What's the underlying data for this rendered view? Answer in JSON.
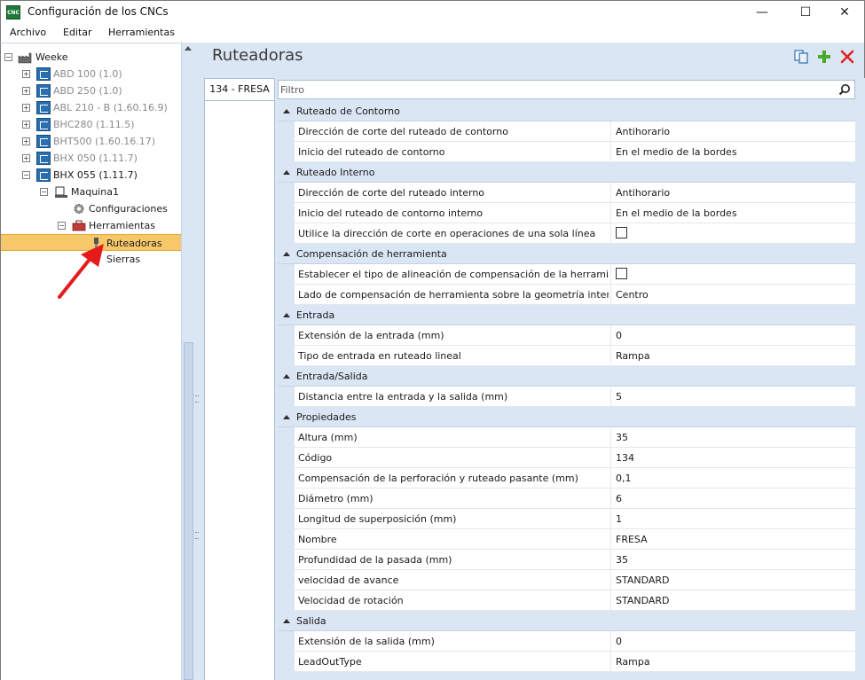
{
  "window": {
    "title": "Configuración de los CNCs",
    "app_icon_text": "CNC",
    "controls": {
      "minimize": "—",
      "maximize": "☐",
      "close": "✕"
    }
  },
  "menu": [
    {
      "label": "Archivo"
    },
    {
      "label": "Editar"
    },
    {
      "label": "Herramientas"
    }
  ],
  "tree": {
    "root": "Weeke",
    "machines": [
      {
        "label": "ABD 100 (1.0)",
        "greyed": true
      },
      {
        "label": "ABD 250 (1.0)",
        "greyed": true
      },
      {
        "label": "ABL 210 - B (1.60.16.9)",
        "greyed": true
      },
      {
        "label": "BHC280 (1.11.5)",
        "greyed": true
      },
      {
        "label": "BHT500 (1.60.16.17)",
        "greyed": true
      },
      {
        "label": "BHX 050 (1.11.7)",
        "greyed": true
      },
      {
        "label": "BHX 055 (1.11.7)",
        "greyed": false
      }
    ],
    "maquina": "Maquina1",
    "configuraciones": "Configuraciones",
    "herramientas": "Herramientas",
    "ruteadoras": "Ruteadoras",
    "sierras": "Sierras"
  },
  "content": {
    "title": "Ruteadoras",
    "toolbar": {
      "copy_icon": "copy-icon",
      "add_icon": "add-icon",
      "delete_icon": "delete-icon"
    },
    "tab_label": "134 - FRESA",
    "filter_placeholder": "Filtro"
  },
  "categories": [
    {
      "label": "Ruteado de Contorno",
      "props": [
        {
          "name": "Dirección de corte del ruteado de contorno",
          "value": "Antihorario"
        },
        {
          "name": "Inicio del ruteado de contorno",
          "value": "En el medio de la bordes"
        }
      ]
    },
    {
      "label": "Ruteado Interno",
      "props": [
        {
          "name": "Dirección de corte del ruteado interno",
          "value": "Antihorario"
        },
        {
          "name": "Inicio del ruteado de contorno interno",
          "value": "En el medio de la bordes"
        },
        {
          "name": "Utilice la dirección de corte en operaciones de una sola línea",
          "checkbox": true,
          "checked": false
        }
      ]
    },
    {
      "label": "Compensación de herramienta",
      "props": [
        {
          "name": "Establecer el tipo de alineación de compensación de la herramienta",
          "checkbox": true,
          "checked": false
        },
        {
          "name": "Lado de compensación de herramienta sobre la geometría interna",
          "value": "Centro"
        }
      ]
    },
    {
      "label": "Entrada",
      "props": [
        {
          "name": "Extensión de la entrada (mm)",
          "value": "0"
        },
        {
          "name": "Tipo de entrada en ruteado lineal",
          "value": "Rampa"
        }
      ]
    },
    {
      "label": "Entrada/Salida",
      "props": [
        {
          "name": "Distancia entre la entrada y la salida (mm)",
          "value": "5"
        }
      ]
    },
    {
      "label": "Propiedades",
      "props": [
        {
          "name": "Altura (mm)",
          "value": "35"
        },
        {
          "name": "Código",
          "value": "134"
        },
        {
          "name": "Compensación de la perforación y ruteado pasante (mm)",
          "value": "0,1"
        },
        {
          "name": "Diámetro (mm)",
          "value": "6"
        },
        {
          "name": "Longitud de superposición (mm)",
          "value": "1"
        },
        {
          "name": "Nombre",
          "value": "FRESA"
        },
        {
          "name": "Profundidad de la pasada (mm)",
          "value": "35"
        },
        {
          "name": "velocidad de avance",
          "value": "STANDARD"
        },
        {
          "name": "Velocidad de rotación",
          "value": "STANDARD"
        }
      ]
    },
    {
      "label": "Salida",
      "props": [
        {
          "name": "Extensión de la salida (mm)",
          "value": "0"
        },
        {
          "name": "LeadOutType",
          "value": "Rampa"
        }
      ]
    }
  ],
  "colors": {
    "panel_bg": "#dbe6f4",
    "selection": "#f7c86a",
    "annotation_arrow": "#e51b1b"
  }
}
